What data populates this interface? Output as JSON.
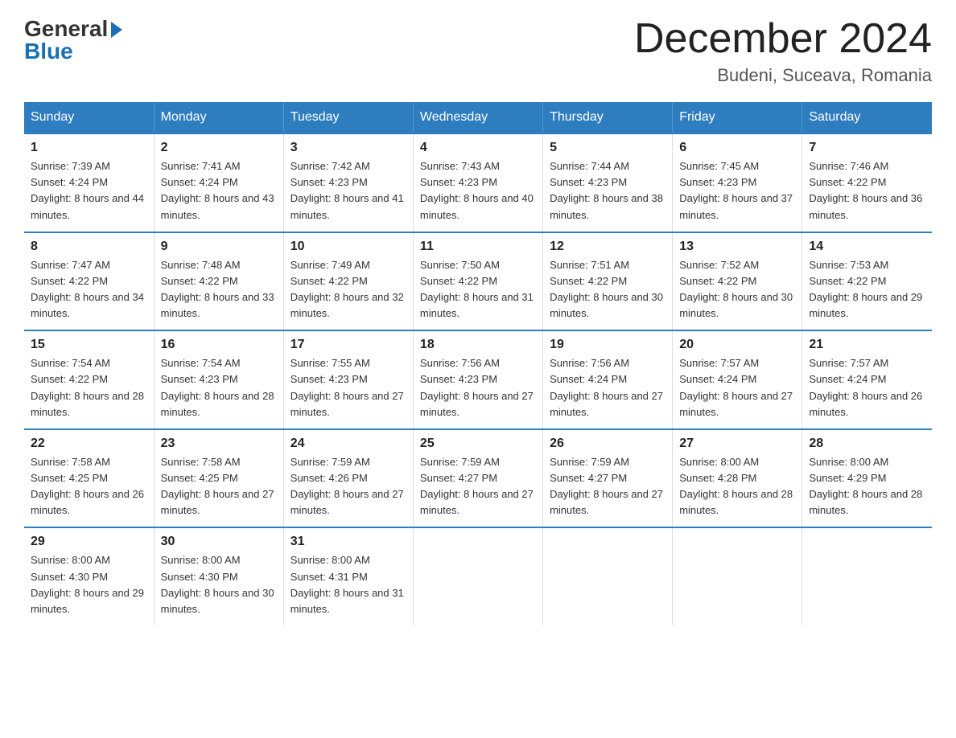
{
  "header": {
    "logo_general": "General",
    "logo_blue": "Blue",
    "month_title": "December 2024",
    "location": "Budeni, Suceava, Romania"
  },
  "days_of_week": [
    "Sunday",
    "Monday",
    "Tuesday",
    "Wednesday",
    "Thursday",
    "Friday",
    "Saturday"
  ],
  "weeks": [
    [
      {
        "day": "1",
        "sunrise": "7:39 AM",
        "sunset": "4:24 PM",
        "daylight": "8 hours and 44 minutes."
      },
      {
        "day": "2",
        "sunrise": "7:41 AM",
        "sunset": "4:24 PM",
        "daylight": "8 hours and 43 minutes."
      },
      {
        "day": "3",
        "sunrise": "7:42 AM",
        "sunset": "4:23 PM",
        "daylight": "8 hours and 41 minutes."
      },
      {
        "day": "4",
        "sunrise": "7:43 AM",
        "sunset": "4:23 PM",
        "daylight": "8 hours and 40 minutes."
      },
      {
        "day": "5",
        "sunrise": "7:44 AM",
        "sunset": "4:23 PM",
        "daylight": "8 hours and 38 minutes."
      },
      {
        "day": "6",
        "sunrise": "7:45 AM",
        "sunset": "4:23 PM",
        "daylight": "8 hours and 37 minutes."
      },
      {
        "day": "7",
        "sunrise": "7:46 AM",
        "sunset": "4:22 PM",
        "daylight": "8 hours and 36 minutes."
      }
    ],
    [
      {
        "day": "8",
        "sunrise": "7:47 AM",
        "sunset": "4:22 PM",
        "daylight": "8 hours and 34 minutes."
      },
      {
        "day": "9",
        "sunrise": "7:48 AM",
        "sunset": "4:22 PM",
        "daylight": "8 hours and 33 minutes."
      },
      {
        "day": "10",
        "sunrise": "7:49 AM",
        "sunset": "4:22 PM",
        "daylight": "8 hours and 32 minutes."
      },
      {
        "day": "11",
        "sunrise": "7:50 AM",
        "sunset": "4:22 PM",
        "daylight": "8 hours and 31 minutes."
      },
      {
        "day": "12",
        "sunrise": "7:51 AM",
        "sunset": "4:22 PM",
        "daylight": "8 hours and 30 minutes."
      },
      {
        "day": "13",
        "sunrise": "7:52 AM",
        "sunset": "4:22 PM",
        "daylight": "8 hours and 30 minutes."
      },
      {
        "day": "14",
        "sunrise": "7:53 AM",
        "sunset": "4:22 PM",
        "daylight": "8 hours and 29 minutes."
      }
    ],
    [
      {
        "day": "15",
        "sunrise": "7:54 AM",
        "sunset": "4:22 PM",
        "daylight": "8 hours and 28 minutes."
      },
      {
        "day": "16",
        "sunrise": "7:54 AM",
        "sunset": "4:23 PM",
        "daylight": "8 hours and 28 minutes."
      },
      {
        "day": "17",
        "sunrise": "7:55 AM",
        "sunset": "4:23 PM",
        "daylight": "8 hours and 27 minutes."
      },
      {
        "day": "18",
        "sunrise": "7:56 AM",
        "sunset": "4:23 PM",
        "daylight": "8 hours and 27 minutes."
      },
      {
        "day": "19",
        "sunrise": "7:56 AM",
        "sunset": "4:24 PM",
        "daylight": "8 hours and 27 minutes."
      },
      {
        "day": "20",
        "sunrise": "7:57 AM",
        "sunset": "4:24 PM",
        "daylight": "8 hours and 27 minutes."
      },
      {
        "day": "21",
        "sunrise": "7:57 AM",
        "sunset": "4:24 PM",
        "daylight": "8 hours and 26 minutes."
      }
    ],
    [
      {
        "day": "22",
        "sunrise": "7:58 AM",
        "sunset": "4:25 PM",
        "daylight": "8 hours and 26 minutes."
      },
      {
        "day": "23",
        "sunrise": "7:58 AM",
        "sunset": "4:25 PM",
        "daylight": "8 hours and 27 minutes."
      },
      {
        "day": "24",
        "sunrise": "7:59 AM",
        "sunset": "4:26 PM",
        "daylight": "8 hours and 27 minutes."
      },
      {
        "day": "25",
        "sunrise": "7:59 AM",
        "sunset": "4:27 PM",
        "daylight": "8 hours and 27 minutes."
      },
      {
        "day": "26",
        "sunrise": "7:59 AM",
        "sunset": "4:27 PM",
        "daylight": "8 hours and 27 minutes."
      },
      {
        "day": "27",
        "sunrise": "8:00 AM",
        "sunset": "4:28 PM",
        "daylight": "8 hours and 28 minutes."
      },
      {
        "day": "28",
        "sunrise": "8:00 AM",
        "sunset": "4:29 PM",
        "daylight": "8 hours and 28 minutes."
      }
    ],
    [
      {
        "day": "29",
        "sunrise": "8:00 AM",
        "sunset": "4:30 PM",
        "daylight": "8 hours and 29 minutes."
      },
      {
        "day": "30",
        "sunrise": "8:00 AM",
        "sunset": "4:30 PM",
        "daylight": "8 hours and 30 minutes."
      },
      {
        "day": "31",
        "sunrise": "8:00 AM",
        "sunset": "4:31 PM",
        "daylight": "8 hours and 31 minutes."
      },
      {
        "day": "",
        "sunrise": "",
        "sunset": "",
        "daylight": ""
      },
      {
        "day": "",
        "sunrise": "",
        "sunset": "",
        "daylight": ""
      },
      {
        "day": "",
        "sunrise": "",
        "sunset": "",
        "daylight": ""
      },
      {
        "day": "",
        "sunrise": "",
        "sunset": "",
        "daylight": ""
      }
    ]
  ],
  "labels": {
    "sunrise_prefix": "Sunrise: ",
    "sunset_prefix": "Sunset: ",
    "daylight_prefix": "Daylight: "
  }
}
